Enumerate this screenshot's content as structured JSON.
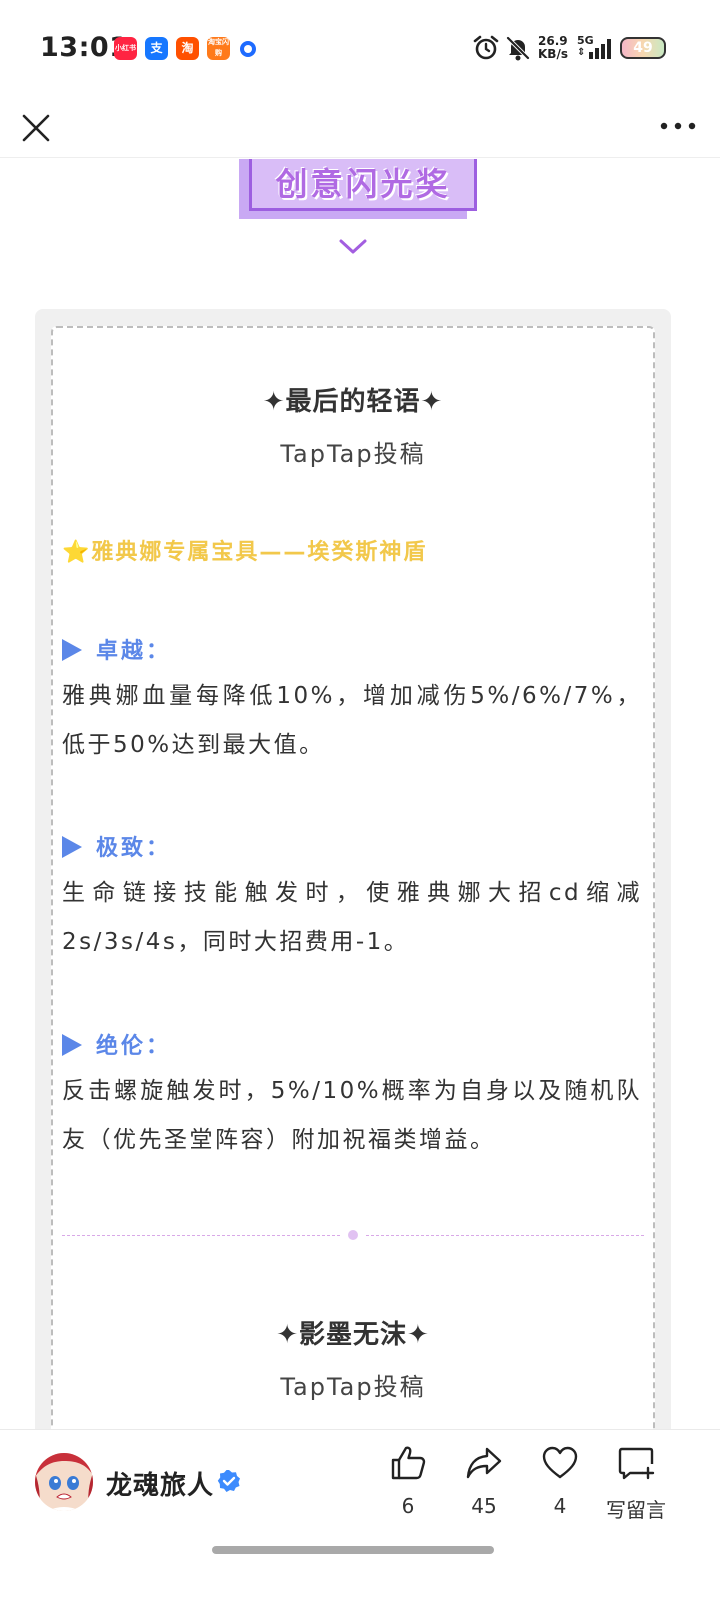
{
  "status_bar": {
    "time": "13:01",
    "app_icons": [
      {
        "name": "xiaohongshu-icon",
        "label": "小红书"
      },
      {
        "name": "alipay-icon",
        "label": "支"
      },
      {
        "name": "taobao-icon",
        "label": "淘"
      },
      {
        "name": "taobao-flash-icon",
        "label": "淘宝闪购"
      },
      {
        "name": "notification-dot-icon",
        "label": ""
      }
    ],
    "net_speed_value": "26.9",
    "net_speed_unit": "KB/s",
    "network_type": "5G",
    "battery": "49"
  },
  "nav": {
    "close_icon": "close-icon",
    "more_icon": "more-icon"
  },
  "article": {
    "award_title": "创意闪光奖",
    "sections": [
      {
        "title": "✦最后的轻语✦",
        "source": "TapTap投稿",
        "item_heading": "⭐雅典娜专属宝具——埃癸斯神盾",
        "entries": [
          {
            "label": "卓越：",
            "text": "雅典娜血量每降低10%，增加减伤5%/6%/7%，低于50%达到最大值。"
          },
          {
            "label": "极致：",
            "text": "生命链接技能触发时，使雅典娜大招cd缩减2s/3s/4s，同时大招费用-1。"
          },
          {
            "label": "绝伦：",
            "text": "反击螺旋触发时，5%/10%概率为自身以及随机队友（优先圣堂阵容）附加祝福类增益。"
          }
        ]
      },
      {
        "title": "✦影墨无沫✦",
        "source": "TapTap投稿"
      }
    ]
  },
  "bottom_bar": {
    "author_name": "龙魂旅人",
    "likes": "6",
    "shares": "45",
    "favorites": "4",
    "comment_label": "写留言"
  },
  "colors": {
    "award_purple": "#b06ae3",
    "heading_yellow": "#f2c84b",
    "subheading_blue": "#5b87e8",
    "verified_blue": "#3d8bfd"
  }
}
